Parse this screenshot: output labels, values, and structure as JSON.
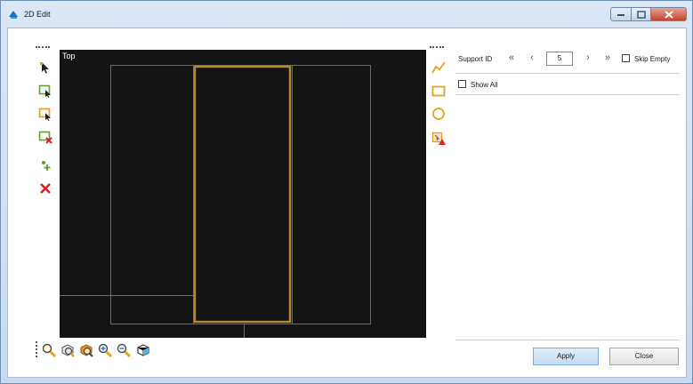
{
  "window": {
    "title": "2D Edit",
    "app_icon": "app-logo-icon",
    "controls": [
      "minimize-icon",
      "maximize-icon",
      "close-icon"
    ],
    "close_color": "#c4442a"
  },
  "left_toolbar": {
    "tools": [
      "select-arrow-icon",
      "select-rect-green-icon",
      "select-rect-orange-icon",
      "delete-rect-icon",
      "add-point-icon",
      "delete-x-icon"
    ]
  },
  "viewport": {
    "label": "Top",
    "background": "#141414",
    "highlight_color": "#b48a2e"
  },
  "bottom_toolbar": {
    "tools": [
      "zoom-icon",
      "zoom-box-icon",
      "zoom-extents-icon",
      "zoom-in-icon",
      "zoom-out-icon",
      "view-cube-icon"
    ]
  },
  "shape_toolbar": {
    "tools": [
      "polyline-icon",
      "rectangle-icon",
      "circle-icon",
      "warning-shape-icon"
    ]
  },
  "support_id": {
    "label": "Support ID",
    "first": "«",
    "prev": "‹",
    "value": "5",
    "next": "›",
    "last": "»",
    "skip_empty_label": "Skip Empty",
    "skip_empty_checked": false
  },
  "show_all": {
    "label": "Show All",
    "checked": false
  },
  "buttons": {
    "apply": "Apply",
    "close": "Close"
  }
}
